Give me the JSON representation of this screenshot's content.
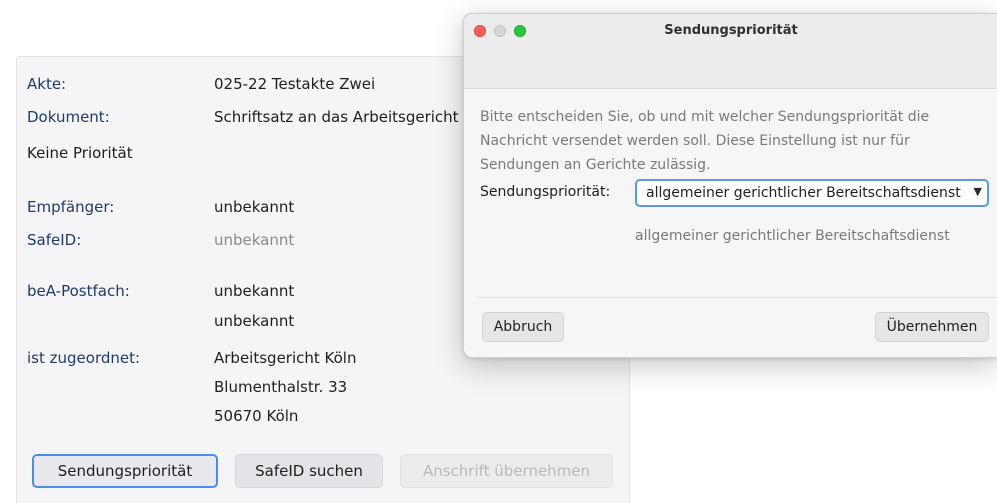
{
  "record": {
    "akte_label": "Akte:",
    "akte_value": "025-22 Testakte Zwei",
    "dokument_label": "Dokument:",
    "dokument_value": "Schriftsatz an das Arbeitsgericht",
    "priority_status": "Keine Priorität",
    "empfaenger_label": "Empfänger:",
    "empfaenger_value": "unbekannt",
    "safeid_label": "SafeID:",
    "safeid_value": "unbekannt",
    "bea_label": "beA-Postfach:",
    "bea_value_1": "unbekannt",
    "bea_value_2": "unbekannt",
    "zugeordnet_label": "ist zugeordnet:",
    "address": [
      "Arbeitsgericht Köln",
      "Blumenthalstr. 33",
      "50670 Köln"
    ]
  },
  "actions": {
    "sendungsprioritaet": "Sendungspriorität",
    "safeid_suchen": "SafeID suchen",
    "anschrift_uebernehmen": "Anschrift übernehmen"
  },
  "dialog": {
    "title": "Sendungspriorität",
    "text_lines": [
      "Bitte entscheiden Sie, ob und mit welcher Sendungspriorität die",
      "Nachricht versendet werden soll. Diese Einstellung ist nur für",
      "Sendungen an Gerichte zulässig."
    ],
    "field_label": "Sendungspriorität:",
    "selected_option": "allgemeiner gerichtlicher Bereitschaftsdienst",
    "option_description": "allgemeiner gerichtlicher Bereitschaftsdienst",
    "cancel_label": "Abbruch",
    "apply_label": "Übernehmen"
  },
  "colors": {
    "label_blue": "#203a6e",
    "focus_blue": "#4a8de8",
    "close_red": "#fe5f57",
    "zoom_green": "#27c840"
  }
}
